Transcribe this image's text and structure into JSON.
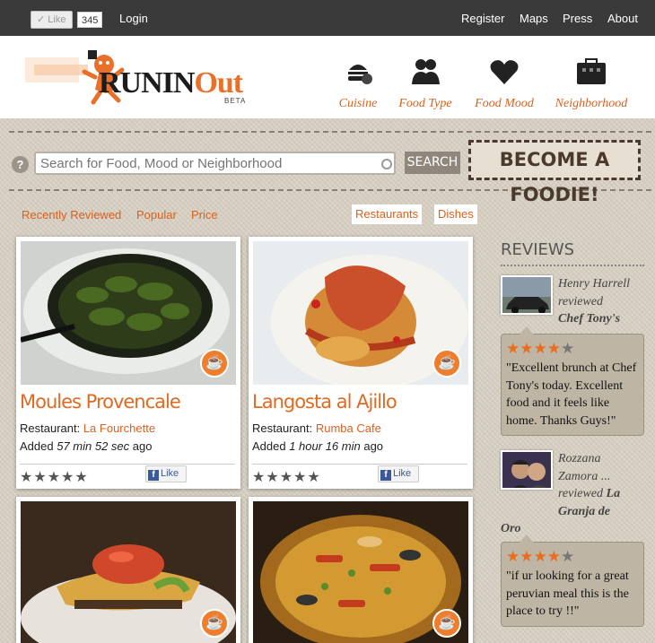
{
  "topbar": {
    "like_label": "Like",
    "like_count": "345",
    "login": "Login",
    "register": "Register",
    "maps": "Maps",
    "press": "Press",
    "about": "About"
  },
  "logo": {
    "name_main": "RUNIN",
    "name_accent": "Out",
    "beta": "BETA"
  },
  "nav": [
    {
      "label": "Cuisine",
      "icon": "burger-icon"
    },
    {
      "label": "Food Type",
      "icon": "people-icon"
    },
    {
      "label": "Food Mood",
      "icon": "heart-icon"
    },
    {
      "label": "Neighborhood",
      "icon": "building-icon"
    }
  ],
  "search": {
    "help": "?",
    "placeholder": "Search for Food, Mood or Neighborhood",
    "button": "SEARCH",
    "cta": "BECOME A FOODIE!"
  },
  "filters": {
    "recently_reviewed": "Recently Reviewed",
    "popular": "Popular",
    "price": "Price",
    "restaurants": "Restaurants",
    "dishes": "Dishes"
  },
  "cards": [
    {
      "title": "Moules Provencale",
      "restaurant_label": "Restaurant:",
      "restaurant": "La Fourchette",
      "added_label": "Added",
      "added_time": "57 min 52 sec",
      "added_suffix": "ago",
      "stars": "★★★★★",
      "like": "Like"
    },
    {
      "title": "Langosta al Ajillo",
      "restaurant_label": "Restaurant:",
      "restaurant": "Rumba Cafe",
      "added_label": "Added",
      "added_time": "1 hour 16 min",
      "added_suffix": "ago",
      "stars": "★★★★★",
      "like": "Like"
    }
  ],
  "reviews": {
    "heading": "REVIEWS",
    "items": [
      {
        "name": "Henry Harrell",
        "action": "reviewed",
        "place": "Chef Tony's",
        "rating": 4,
        "text": "\"Excellent brunch at Chef Tony's today. Excellent food and it feels like home. Thanks Guys!\""
      },
      {
        "name_line1": "Rozzana",
        "name_line2": "Zamora ...",
        "action": "reviewed",
        "place_part1": "La",
        "place_part2": "Granja de",
        "place_part3": "Oro",
        "rating": 4,
        "text": "\"if ur looking for a great peruvian meal this is the place to try !!\""
      }
    ]
  },
  "colors": {
    "accent": "#d9601e",
    "topbar": "#3a3a3a",
    "bubble": "#bfb5a4"
  }
}
